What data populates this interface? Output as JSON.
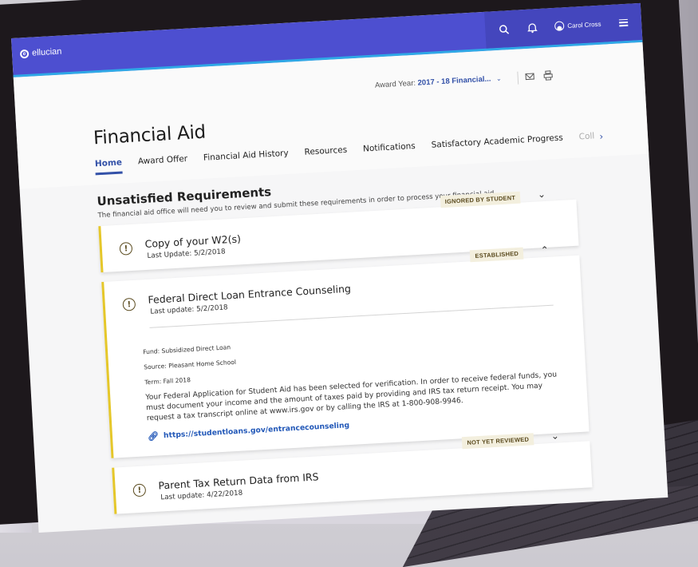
{
  "header": {
    "logo_text": "ellucian",
    "user_name": "Carol Cross",
    "icons": [
      "search-icon",
      "bell-icon",
      "user-avatar-icon",
      "menu-icon"
    ]
  },
  "page": {
    "title": "Financial Aid",
    "award_year_label": "Award Year:",
    "award_year_value": "2017 - 18 Financial...",
    "award_year_chevron": "⌄",
    "mail_icon": "mail-icon",
    "print_icon": "print-icon"
  },
  "tabs": [
    {
      "label": "Home",
      "active": true
    },
    {
      "label": "Award Offer"
    },
    {
      "label": "Financial Aid History"
    },
    {
      "label": "Resources"
    },
    {
      "label": "Notifications"
    },
    {
      "label": "Satisfactory Academic Progress"
    },
    {
      "label": "Coll"
    }
  ],
  "tab_next_icon": "›",
  "section": {
    "title": "Unsatisfied Requirements",
    "subtitle": "The financial aid office will need you to review and submit these requirements in order to process your financial aid."
  },
  "requirements": [
    {
      "title": "Copy of your W2(s)",
      "date": "Last Update:  5/2/2018",
      "status": "IGNORED BY STUDENT",
      "toggle": "⌄",
      "expanded": false
    },
    {
      "title": "Federal Direct Loan Entrance Counseling",
      "date": "Last update:  5/2/2018",
      "status": "ESTABLISHED",
      "toggle": "⌃",
      "expanded": true,
      "fund": "Fund:  Subsidized Direct Loan",
      "source": "Source:  Pleasant Home School",
      "term": "Term:  Fall 2018",
      "description": "Your Federal Application for Student Aid has been selected for verification. In order to receive federal funds, you must document your income and the amount of taxes paid by providing and IRS tax return receipt. You may request a tax transcript online at www.irs.gov or by calling the IRS at 1-800-908-9946.",
      "link": "https://studentloans.gov/entrancecounseling"
    },
    {
      "title": "Parent Tax Return Data from IRS",
      "date": "Last update:  4/22/2018",
      "status": "NOT YET REVIEWED",
      "toggle": "⌄",
      "expanded": false
    }
  ],
  "colors": {
    "header_bg": "#4d4fd0",
    "header_accent": "#2fa8e6",
    "link": "#2258b8",
    "active_tab": "#3351a8",
    "warning_bar": "#e5c72a",
    "badge_bg": "#f3efde"
  }
}
